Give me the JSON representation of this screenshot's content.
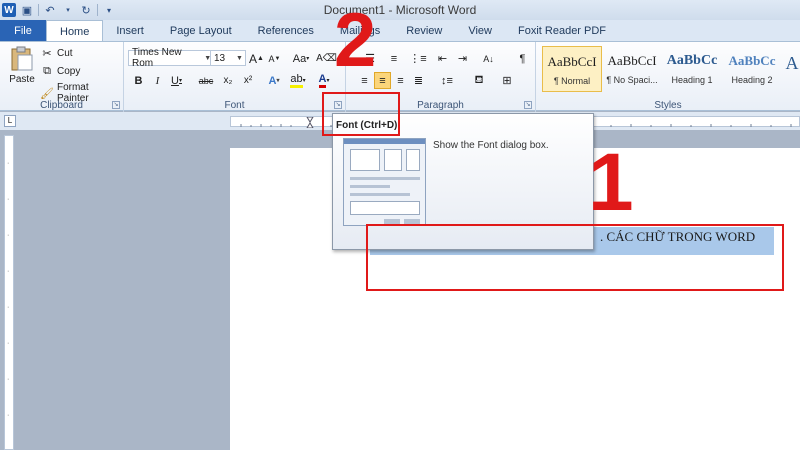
{
  "window": {
    "title": "Document1 - Microsoft Word"
  },
  "qat": {
    "logo": "W"
  },
  "tabs": [
    {
      "label": "File"
    },
    {
      "label": "Home"
    },
    {
      "label": "Insert"
    },
    {
      "label": "Page Layout"
    },
    {
      "label": "References"
    },
    {
      "label": "Mailings"
    },
    {
      "label": "Review"
    },
    {
      "label": "View"
    },
    {
      "label": "Foxit Reader PDF"
    }
  ],
  "clipboard": {
    "paste": "Paste",
    "cut": "Cut",
    "copy": "Copy",
    "format_painter": "Format Painter",
    "group_label": "Clipboard"
  },
  "font": {
    "name": "Times New Rom",
    "size": "13",
    "group_label": "Font",
    "bold": "B",
    "italic": "I",
    "underline": "U",
    "strike": "abc",
    "subscript": "x₂",
    "superscript": "x²",
    "grow": "A",
    "shrink": "A",
    "case": "Aa"
  },
  "paragraph": {
    "group_label": "Paragraph",
    "pilcrow": "¶"
  },
  "styles": {
    "group_label": "Styles",
    "items": [
      {
        "sample": "AaBbCcI",
        "name": "¶ Normal"
      },
      {
        "sample": "AaBbCcI",
        "name": "¶ No Spaci..."
      },
      {
        "sample": "AaBbCc",
        "name": "Heading 1"
      },
      {
        "sample": "AaBbCc",
        "name": "Heading 2"
      }
    ]
  },
  "tooltip": {
    "title": "Font (Ctrl+D)",
    "description": "Show the Font dialog box."
  },
  "document": {
    "selected_text": ". CÁC CHỮ TRONG WORD"
  },
  "annotations": {
    "step1": "1",
    "step2": "2"
  },
  "colors": {
    "annotation_red": "#e01919",
    "selection": "#a9c8ea",
    "file_tab": "#2a64b5"
  }
}
